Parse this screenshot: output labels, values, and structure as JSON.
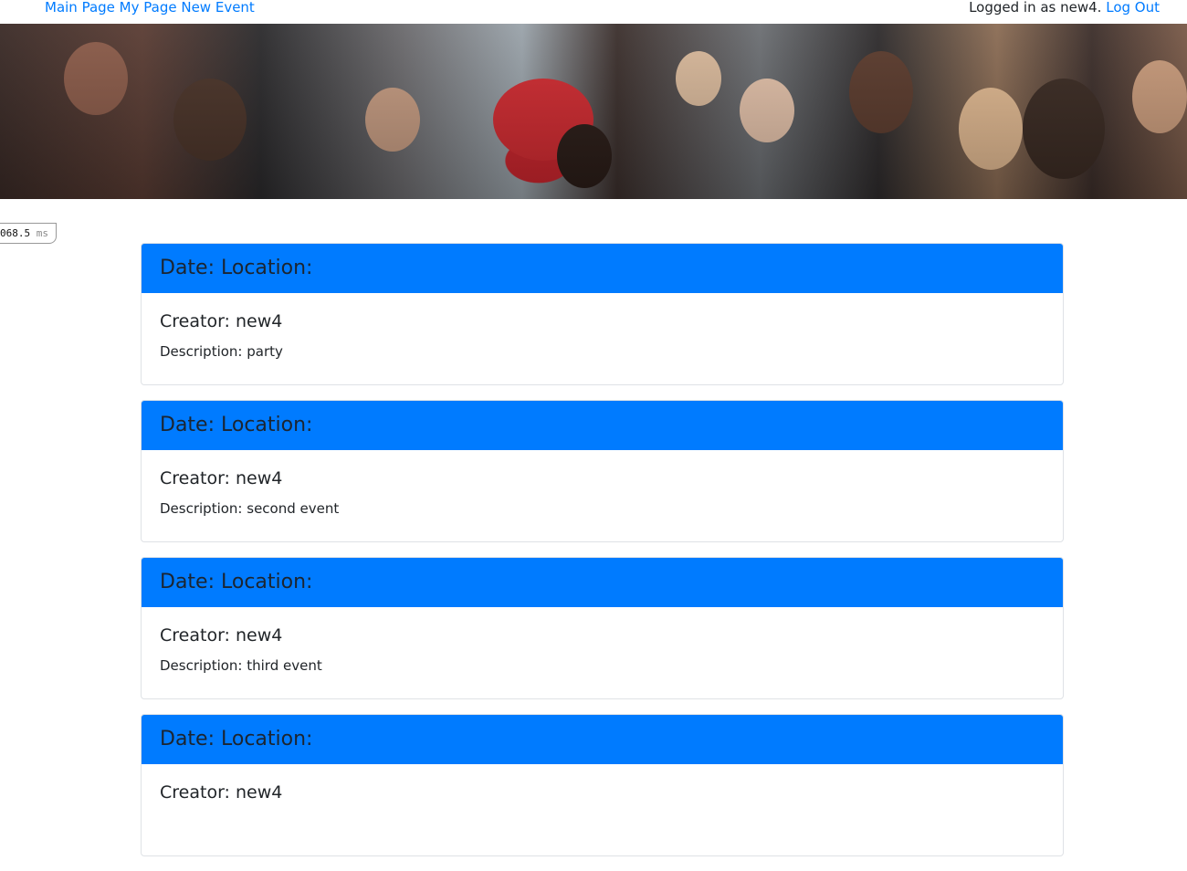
{
  "nav": {
    "main_page": "Main Page",
    "my_page": "My Page",
    "new_event": "New Event",
    "logged_in_text": "Logged in as new4.",
    "log_out": "Log Out"
  },
  "timer": {
    "value": "068.5",
    "unit": "ms"
  },
  "events": [
    {
      "header": "Date: Location:",
      "creator": "Creator: new4",
      "description": "Description: party"
    },
    {
      "header": "Date: Location:",
      "creator": "Creator: new4",
      "description": "Description: second event"
    },
    {
      "header": "Date: Location:",
      "creator": "Creator: new4",
      "description": "Description: third event"
    },
    {
      "header": "Date: Location:",
      "creator": "Creator: new4",
      "description": ""
    }
  ],
  "colors": {
    "link": "#007bff",
    "card_header": "#007bff"
  }
}
